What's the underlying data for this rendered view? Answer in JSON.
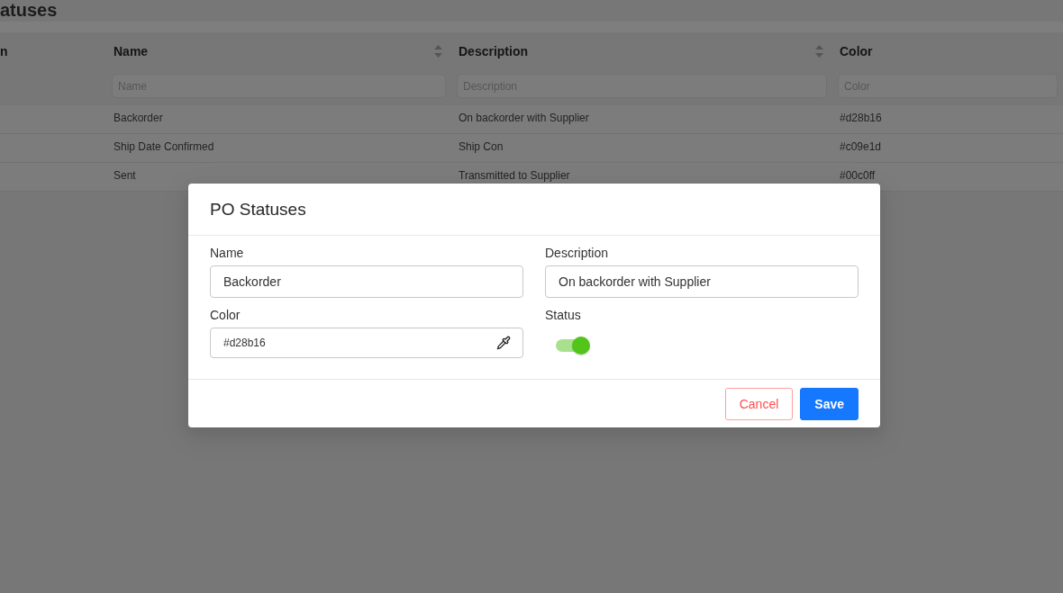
{
  "page": {
    "heading": "atuses"
  },
  "table": {
    "columns": [
      {
        "label": "n",
        "sortable": false
      },
      {
        "label": "Name",
        "sortable": true
      },
      {
        "label": "Description",
        "sortable": true
      },
      {
        "label": "Color",
        "sortable": false
      }
    ],
    "filters": [
      {
        "placeholder": "Name"
      },
      {
        "placeholder": "Description"
      },
      {
        "placeholder": "Color"
      }
    ],
    "rows": [
      {
        "cells": [
          "",
          "Backorder",
          "On backorder with Supplier",
          "#d28b16"
        ]
      },
      {
        "cells": [
          "",
          "Ship Date Confirmed",
          "Ship Con",
          "#c09e1d"
        ]
      },
      {
        "cells": [
          "",
          "Sent",
          "Transmitted to Supplier",
          "#00c0ff"
        ]
      }
    ]
  },
  "dialog": {
    "title": "PO Statuses",
    "fields": [
      {
        "kind": "text",
        "label": "Name",
        "value": "Backorder"
      },
      {
        "kind": "text",
        "label": "Description",
        "value": "On backorder with Supplier"
      },
      {
        "kind": "color",
        "label": "Color",
        "value": "#d28b16"
      },
      {
        "kind": "switch",
        "label": "Status",
        "on": true
      }
    ],
    "buttons": [
      {
        "kind": "secondary",
        "label": "Cancel"
      },
      {
        "kind": "primary",
        "label": "Save"
      }
    ]
  }
}
